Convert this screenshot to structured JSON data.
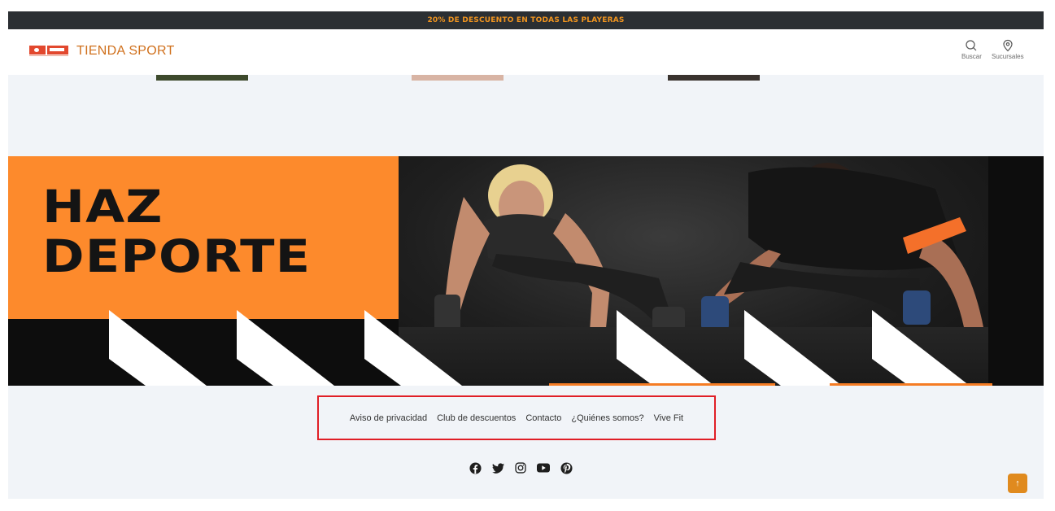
{
  "promo": {
    "text": "20% DE DESCUENTO EN TODAS LAS PLAYERAS"
  },
  "header": {
    "logo_text": "TIENDA SPORT",
    "search_label": "Buscar",
    "branches_label": "Sucursales"
  },
  "banner": {
    "title_line1": "HAZ",
    "title_line2": "DEPORTE"
  },
  "footer": {
    "links": [
      {
        "label": "Aviso de privacidad"
      },
      {
        "label": "Club de descuentos"
      },
      {
        "label": "Contacto"
      },
      {
        "label": "¿Quiénes somos?"
      },
      {
        "label": "Vive Fit"
      }
    ],
    "social_icons": [
      "facebook-icon",
      "twitter-icon",
      "instagram-icon",
      "youtube-icon",
      "pinterest-icon"
    ]
  },
  "colors": {
    "brand_orange": "#fd8a2c",
    "promo_bg": "#2b2f33",
    "promo_text": "#f0941f",
    "highlight_border": "#e01e26"
  },
  "scroll_top": {
    "icon": "arrow-up-icon",
    "glyph": "↑"
  }
}
